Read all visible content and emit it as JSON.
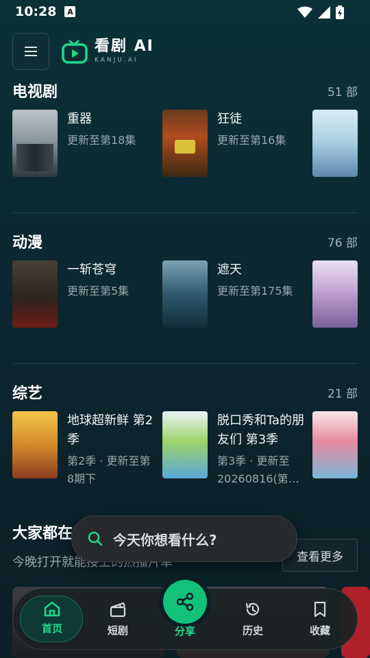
{
  "status": {
    "time": "10:28",
    "notif_icon": "A"
  },
  "header": {
    "app_name": "看剧 AI",
    "app_sub": "KANJU.AI",
    "brand_color": "#22d889"
  },
  "sections": [
    {
      "title": "电视剧",
      "count": "51 部",
      "items": [
        {
          "title": "重器",
          "sub": "更新至第18集"
        },
        {
          "title": "狂徒",
          "sub": "更新至第16集"
        }
      ]
    },
    {
      "title": "动漫",
      "count": "76 部",
      "items": [
        {
          "title": "一斩苍穹",
          "sub": "更新至第5集"
        },
        {
          "title": "遮天",
          "sub": "更新至第175集"
        }
      ]
    },
    {
      "title": "综艺",
      "count": "21 部",
      "items": [
        {
          "title": "地球超新鲜 第2季",
          "sub": "第2季 · 更新至第8期下"
        },
        {
          "title": "脱口秀和Ta的朋友们 第3季",
          "sub": "第3季 · 更新至20260816(第…"
        }
      ]
    }
  ],
  "watching": {
    "title": "大家都在",
    "sub": "今晚打开就能接上的热播片单",
    "more": "查看更多"
  },
  "search": {
    "placeholder": "今天你想看什么?"
  },
  "nav": {
    "home": "首页",
    "shorts": "短剧",
    "share": "分享",
    "history": "历史",
    "favorites": "收藏"
  }
}
